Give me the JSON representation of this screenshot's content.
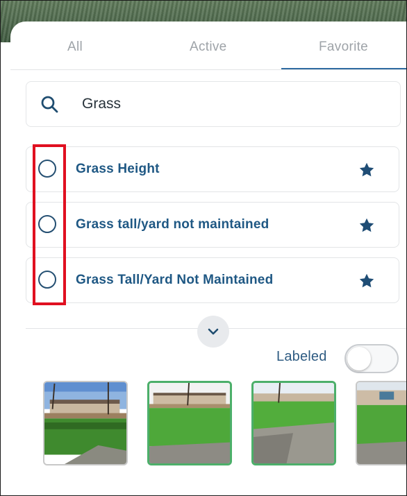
{
  "tabs": [
    {
      "label": "All"
    },
    {
      "label": "Active"
    },
    {
      "label": "Favorite"
    }
  ],
  "selected_tab": "Favorite",
  "search": {
    "value": "Grass",
    "icon": "search-icon"
  },
  "items": [
    {
      "label": "Grass Height",
      "favorite": true
    },
    {
      "label": "Grass tall/yard not maintained",
      "favorite": true
    },
    {
      "label": "Grass Tall/Yard Not Maintained",
      "favorite": true
    }
  ],
  "expand_icon": "chevron-down-icon",
  "labeled_toggle": {
    "label": "Labeled",
    "on": false
  },
  "thumbnails": [
    {
      "selected": false
    },
    {
      "selected": true
    },
    {
      "selected": true
    },
    {
      "selected": false
    }
  ],
  "colors": {
    "accent": "#2e6aa0",
    "item_text": "#1f5884",
    "highlight": "#e01020",
    "thumbnail_selected": "#4caf6a"
  }
}
